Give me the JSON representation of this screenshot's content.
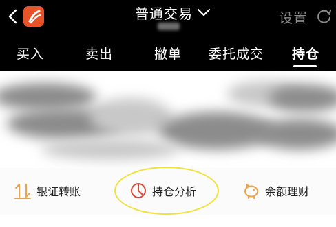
{
  "header": {
    "title": "普通交易",
    "settings_label": "设置",
    "back_icon": "back-icon",
    "refresh_icon": "refresh-icon",
    "dropdown_icon": "chevron-down-icon"
  },
  "tabs": [
    {
      "label": "买入"
    },
    {
      "label": "卖出"
    },
    {
      "label": "撤单"
    },
    {
      "label": "委托成交"
    },
    {
      "label": "持仓",
      "active": true
    }
  ],
  "actions": [
    {
      "label": "银证转账",
      "icon": "transfer-icon"
    },
    {
      "label": "持仓分析",
      "icon": "pie-chart-icon"
    },
    {
      "label": "余额理财",
      "icon": "piggy-bank-icon"
    }
  ],
  "colors": {
    "header_bg": "#000000",
    "accent_orange": "#e8542a",
    "icon_orange": "#f0a24a",
    "analysis_red": "#d84b3c",
    "highlight_yellow": "#efe23a"
  }
}
